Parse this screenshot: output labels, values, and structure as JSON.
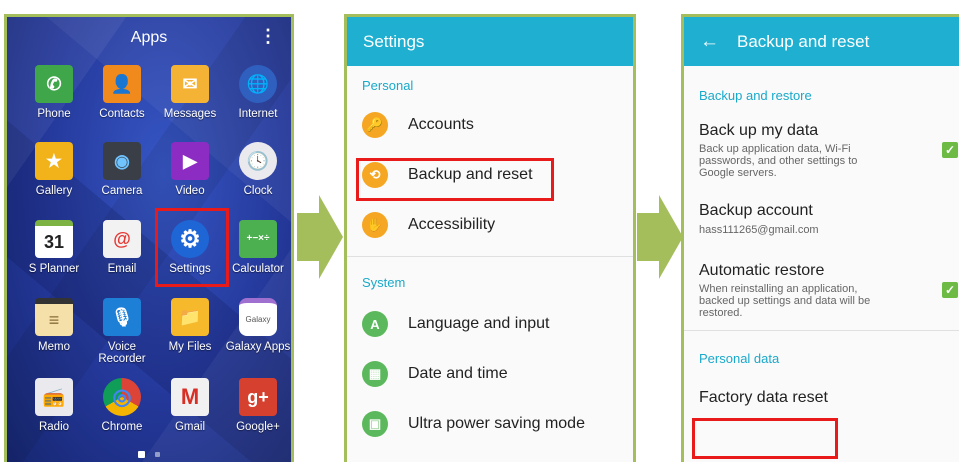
{
  "apps_screen": {
    "title": "Apps",
    "menu_glyph": "⋮",
    "apps": [
      {
        "label": "Phone",
        "glyph": "✆",
        "color": "#3fa64a"
      },
      {
        "label": "Contacts",
        "glyph": "👤",
        "color": "#f08a1d"
      },
      {
        "label": "Messages",
        "glyph": "✉",
        "color": "#f5b335"
      },
      {
        "label": "Internet",
        "glyph": "🌐",
        "color": "#2f5fbf"
      },
      {
        "label": "Gallery",
        "glyph": "★",
        "color": "#f2b21a"
      },
      {
        "label": "Camera",
        "glyph": "◉",
        "color": "#3a3f47"
      },
      {
        "label": "Video",
        "glyph": "▶",
        "color": "#8c2cc2"
      },
      {
        "label": "Clock",
        "glyph": "🕓",
        "color": "#e9e9ee"
      },
      {
        "label": "S Planner",
        "glyph": "31",
        "color": "#ffffff"
      },
      {
        "label": "Email",
        "glyph": "@",
        "color": "#f2f2f2"
      },
      {
        "label": "Settings",
        "glyph": "⚙",
        "color": "#1e66d6"
      },
      {
        "label": "Calculator",
        "glyph": "+−×÷",
        "color": "#4caf50"
      },
      {
        "label": "Memo",
        "glyph": "≡",
        "color": "#f4e0a8"
      },
      {
        "label": "Voice Recorder",
        "glyph": "🎙",
        "color": "#1d7fd6"
      },
      {
        "label": "My Files",
        "glyph": "📁",
        "color": "#f6b92b"
      },
      {
        "label": "Galaxy Apps",
        "glyph": "Galaxy",
        "color": "#ffffff"
      },
      {
        "label": "Radio",
        "glyph": "📻",
        "color": "#e9e9ee"
      },
      {
        "label": "Chrome",
        "glyph": "◎",
        "color": "#db4437"
      },
      {
        "label": "Gmail",
        "glyph": "M",
        "color": "#f1f1f1"
      },
      {
        "label": "Google+",
        "glyph": "g+",
        "color": "#d6402f"
      }
    ]
  },
  "settings_screen": {
    "title": "Settings",
    "sections": [
      {
        "header": "Personal",
        "items": [
          {
            "label": "Accounts",
            "glyph": "🔑",
            "color": "#f5a623"
          },
          {
            "label": "Backup and reset",
            "glyph": "⟲",
            "color": "#f5a623"
          },
          {
            "label": "Accessibility",
            "glyph": "✋",
            "color": "#f5a623"
          }
        ]
      },
      {
        "header": "System",
        "items": [
          {
            "label": "Language and input",
            "glyph": "A",
            "color": "#5cb85c"
          },
          {
            "label": "Date and time",
            "glyph": "▦",
            "color": "#5cb85c"
          },
          {
            "label": "Ultra power saving mode",
            "glyph": "▣",
            "color": "#5cb85c"
          }
        ]
      }
    ]
  },
  "backup_screen": {
    "back_glyph": "←",
    "title": "Backup and reset",
    "section1": "Backup and restore",
    "backup_data": {
      "title": "Back up my data",
      "desc": "Back up application data, Wi-Fi passwords, and other settings to Google servers.",
      "checked": true
    },
    "backup_account": {
      "title": "Backup account",
      "value": "hass111265@gmail.com"
    },
    "auto_restore": {
      "title": "Automatic restore",
      "desc": "When reinstalling an application, backed up settings and data will be restored.",
      "checked": true
    },
    "section2": "Personal data",
    "factory_reset": "Factory data reset",
    "check_glyph": "✓"
  },
  "colors": {
    "accent": "#1fb0d1",
    "highlight": "#e81a1a",
    "arrow": "#a4be5c",
    "checkbox": "#6dbb45"
  }
}
